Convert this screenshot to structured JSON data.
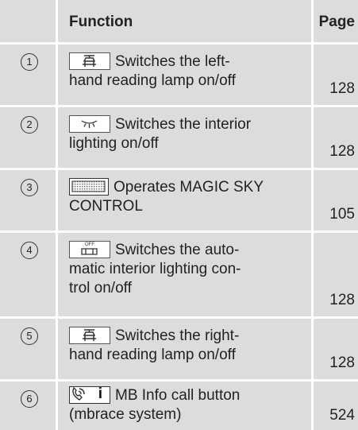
{
  "header": {
    "function": "Function",
    "page": "Page"
  },
  "rows": [
    {
      "number": "1",
      "icon": "reading-lamp-icon",
      "text_first": "Switches the left-",
      "text_rest": "hand reading lamp on/off",
      "page": "128"
    },
    {
      "number": "2",
      "icon": "interior-light-icon",
      "text_first": "Switches the interior",
      "text_rest": "lighting on/off",
      "page": "128"
    },
    {
      "number": "3",
      "icon": "magic-sky-icon",
      "text_first": "Operates MAGIC SKY",
      "text_rest": "CONTROL",
      "page": "105"
    },
    {
      "number": "4",
      "icon": "auto-interior-light-off-icon",
      "icon_text": "OFF",
      "text_first": "Switches the auto-",
      "text_rest": "matic interior lighting con-",
      "text_rest2": "trol on/off",
      "page": "128"
    },
    {
      "number": "5",
      "icon": "reading-lamp-icon",
      "text_first": "Switches the right-",
      "text_rest": "hand reading lamp on/off",
      "page": "128"
    },
    {
      "number": "6",
      "icon": "phone-info-icon",
      "icon_text": "i",
      "text_first": "MB Info call button",
      "text_rest": "(mbrace system)",
      "page": "524"
    }
  ]
}
